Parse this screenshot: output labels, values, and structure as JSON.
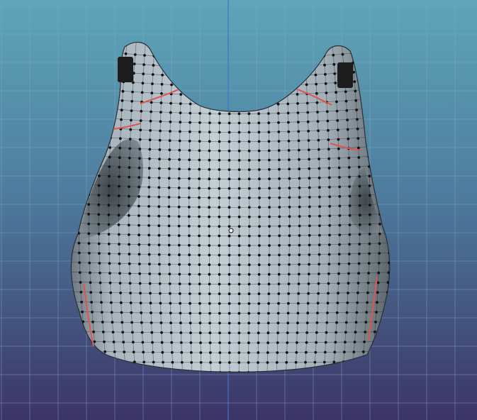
{
  "viewport": {
    "view": "front",
    "background_top": "#5ea6b8",
    "background_bottom": "#3c3466",
    "grid_color": "#86a9c4",
    "axis_color": "#3f74c9"
  },
  "mesh": {
    "object": "crop-top",
    "surface_color": "#b8c4cc",
    "wire_color": "#2a2f33",
    "vertex_color": "#111111",
    "seam_color": "#e0554f",
    "strap_cap_color": "#1c1c1c",
    "pivot_color": "#ffffff"
  }
}
